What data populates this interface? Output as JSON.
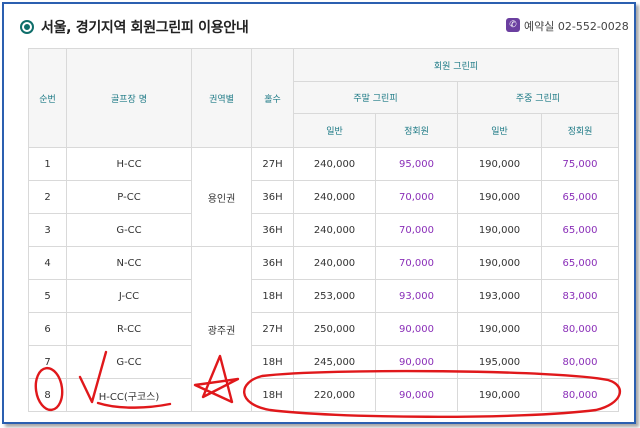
{
  "header": {
    "title": "서울, 경기지역 회원그린피 이용안내",
    "phone_label": "예약실 02-552-0028",
    "icons": [
      "circle-bullet-icon",
      "phone-icon"
    ]
  },
  "colors": {
    "accent": "#0f6e6a",
    "header_text": "#1e7a86",
    "member_price": "#8a2fb8",
    "annotation": "#e0181b",
    "frame": "#2b5fb0"
  },
  "table": {
    "headers": {
      "no": "순번",
      "course": "골프장 명",
      "region": "권역별",
      "holes": "홀수",
      "fee_group": "회원 그린피",
      "weekend": "주말 그린피",
      "weekday": "주중 그린피",
      "regular": "일반",
      "member": "정회원"
    },
    "regions": [
      "용인권",
      "광주권"
    ],
    "rows": [
      {
        "no": "1",
        "course": "H-CC",
        "holes": "27H",
        "we_regular": "240,000",
        "we_member": "95,000",
        "wd_regular": "190,000",
        "wd_member": "75,000"
      },
      {
        "no": "2",
        "course": "P-CC",
        "holes": "36H",
        "we_regular": "240,000",
        "we_member": "70,000",
        "wd_regular": "190,000",
        "wd_member": "65,000"
      },
      {
        "no": "3",
        "course": "G-CC",
        "holes": "36H",
        "we_regular": "240,000",
        "we_member": "70,000",
        "wd_regular": "190,000",
        "wd_member": "65,000"
      },
      {
        "no": "4",
        "course": "N-CC",
        "holes": "36H",
        "we_regular": "240,000",
        "we_member": "70,000",
        "wd_regular": "190,000",
        "wd_member": "65,000"
      },
      {
        "no": "5",
        "course": "J-CC",
        "holes": "18H",
        "we_regular": "253,000",
        "we_member": "93,000",
        "wd_regular": "193,000",
        "wd_member": "83,000"
      },
      {
        "no": "6",
        "course": "R-CC",
        "holes": "27H",
        "we_regular": "250,000",
        "we_member": "90,000",
        "wd_regular": "190,000",
        "wd_member": "80,000"
      },
      {
        "no": "7",
        "course": "G-CC",
        "holes": "18H",
        "we_regular": "245,000",
        "we_member": "90,000",
        "wd_regular": "195,000",
        "wd_member": "80,000"
      },
      {
        "no": "8",
        "course": "H-CC(구코스)",
        "holes": "18H",
        "we_regular": "220,000",
        "we_member": "90,000",
        "wd_regular": "190,000",
        "wd_member": "80,000"
      }
    ]
  }
}
